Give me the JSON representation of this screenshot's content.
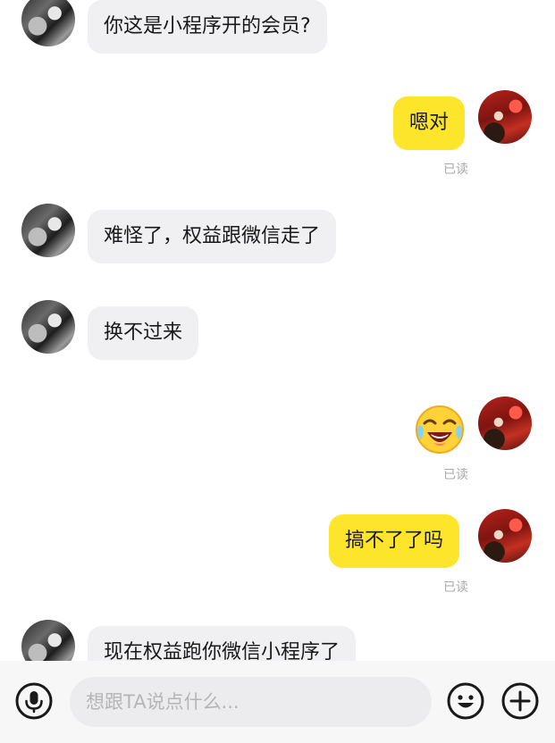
{
  "messages": [
    {
      "from": "other",
      "text": "你这是小程序开的会员?"
    },
    {
      "from": "self",
      "text": "嗯对",
      "status": "已读"
    },
    {
      "from": "other",
      "text": "难怪了，权益跟微信走了"
    },
    {
      "from": "other",
      "text": "换不过来"
    },
    {
      "from": "self",
      "emoji": "laughing-crying-emoji",
      "status": "已读"
    },
    {
      "from": "self",
      "text": "搞不了了吗",
      "status": "已读"
    },
    {
      "from": "other",
      "text": "现在权益跑你微信小程序了"
    }
  ],
  "input": {
    "placeholder": "想跟TA说点什么..."
  },
  "icons": {
    "voice": "microphone-icon",
    "emoji": "smiley-icon",
    "more": "plus-icon"
  },
  "colors": {
    "self_bubble": "#fde52b",
    "other_bubble": "#f0f0f2",
    "read_status": "#a9a9a9"
  }
}
